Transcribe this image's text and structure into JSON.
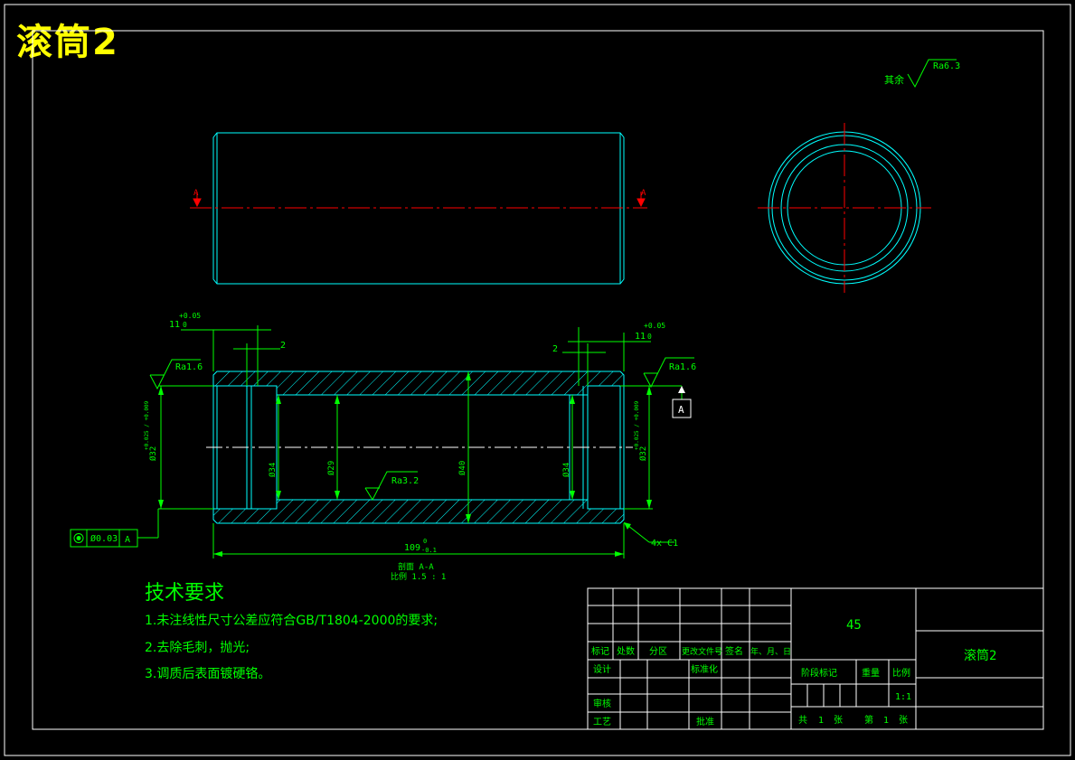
{
  "title": "滚筒2",
  "colors": {
    "background": "#000000",
    "frame": "#ffffff",
    "outline": "#00ffff",
    "centerline": "#ff0000",
    "dimension": "#00ff00",
    "title_text": "#ffff00"
  },
  "views": {
    "section_label": "A",
    "roughness_other": "其余",
    "roughness_other_value": "Ra6.3",
    "roughness_left": "Ra1.6",
    "roughness_right": "Ra1.6",
    "roughness_inner": "Ra3.2",
    "datum": "A",
    "runout_value": "0.03",
    "runout_datum": "A",
    "chamfer": "4x C1",
    "section_caption": "剖面 A-A",
    "section_scale": "比例 1.5 : 1"
  },
  "dimensions": {
    "left_depth": "11",
    "left_depth_upper": "+0.05",
    "left_depth_lower": "0",
    "right_depth": "11",
    "right_depth_upper": "+0.05",
    "right_depth_lower": "0",
    "left_groove": "2",
    "right_groove": "2",
    "left_outer_dia": "Ø32",
    "left_outer_tol": "+0.025 / +0.009",
    "right_outer_dia": "Ø32",
    "right_outer_tol": "+0.025 / +0.009",
    "bore_left": "Ø34",
    "bore_mid": "Ø29",
    "outer_dia": "Ø40",
    "bore_right": "Ø34",
    "length": "109",
    "length_upper": "0",
    "length_lower": "-0.1"
  },
  "requirements": {
    "heading": "技术要求",
    "items": [
      "1.未注线性尺寸公差应符合GB/T1804-2000的要求;",
      "2.去除毛刺，抛光;",
      "3.调质后表面镀硬铬。"
    ]
  },
  "title_block": {
    "material": "45",
    "part_name": "滚筒2",
    "headers": [
      "标记",
      "处数",
      "分区",
      "更改文件号",
      "签名",
      "年、月、日"
    ],
    "design": "设计",
    "standardize": "标准化",
    "review": "审核",
    "process": "工艺",
    "approve": "批准",
    "stage_mark": "阶段标记",
    "weight": "重量",
    "scale_label": "比例",
    "scale_value": "1:1",
    "sheet_total_label": "共",
    "sheet_total": "1",
    "sheet_unit": "张",
    "sheet_no_label": "第",
    "sheet_no": "1",
    "sheet_no_unit": "张"
  }
}
